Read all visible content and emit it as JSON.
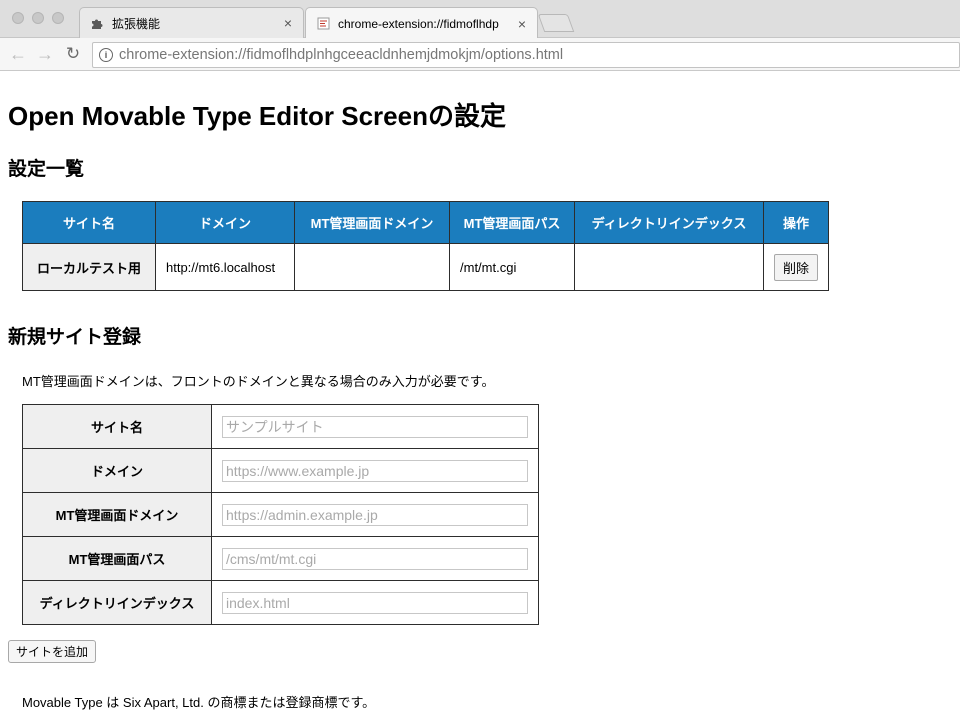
{
  "browser": {
    "tabs": [
      {
        "title": "拡張機能",
        "icon": "puzzle-icon"
      },
      {
        "title": "chrome-extension://fidmoflhdp",
        "icon": "extension-page-icon"
      }
    ],
    "close_glyph": "×",
    "url": "chrome-extension://fidmoflhdplnhgceeacldnhemjdmokjm/options.html"
  },
  "page": {
    "title": "Open Movable Type Editor Screenの設定",
    "list_heading": "設定一覧",
    "table": {
      "headers": [
        "サイト名",
        "ドメイン",
        "MT管理画面ドメイン",
        "MT管理画面パス",
        "ディレクトリインデックス",
        "操作"
      ],
      "rows": [
        {
          "site_name": "ローカルテスト用",
          "domain": "http://mt6.localhost",
          "admin_domain": "",
          "admin_path": "/mt/mt.cgi",
          "directory_index": "",
          "action": "削除"
        }
      ]
    },
    "new_heading": "新規サイト登録",
    "note": "MT管理画面ドメインは、フロントのドメインと異なる場合のみ入力が必要です。",
    "form": {
      "fields": [
        {
          "label": "サイト名",
          "placeholder": "サンプルサイト",
          "value": ""
        },
        {
          "label": "ドメイン",
          "placeholder": "https://www.example.jp",
          "value": ""
        },
        {
          "label": "MT管理画面ドメイン",
          "placeholder": "https://admin.example.jp",
          "value": ""
        },
        {
          "label": "MT管理画面パス",
          "placeholder": "/cms/mt/mt.cgi",
          "value": ""
        },
        {
          "label": "ディレクトリインデックス",
          "placeholder": "index.html",
          "value": ""
        }
      ]
    },
    "add_button": "サイトを追加",
    "footer": "Movable Type は Six Apart, Ltd. の商標または登録商標です。"
  },
  "colors": {
    "table_header_bg": "#1b7dbe",
    "row_header_bg": "#efefef"
  }
}
